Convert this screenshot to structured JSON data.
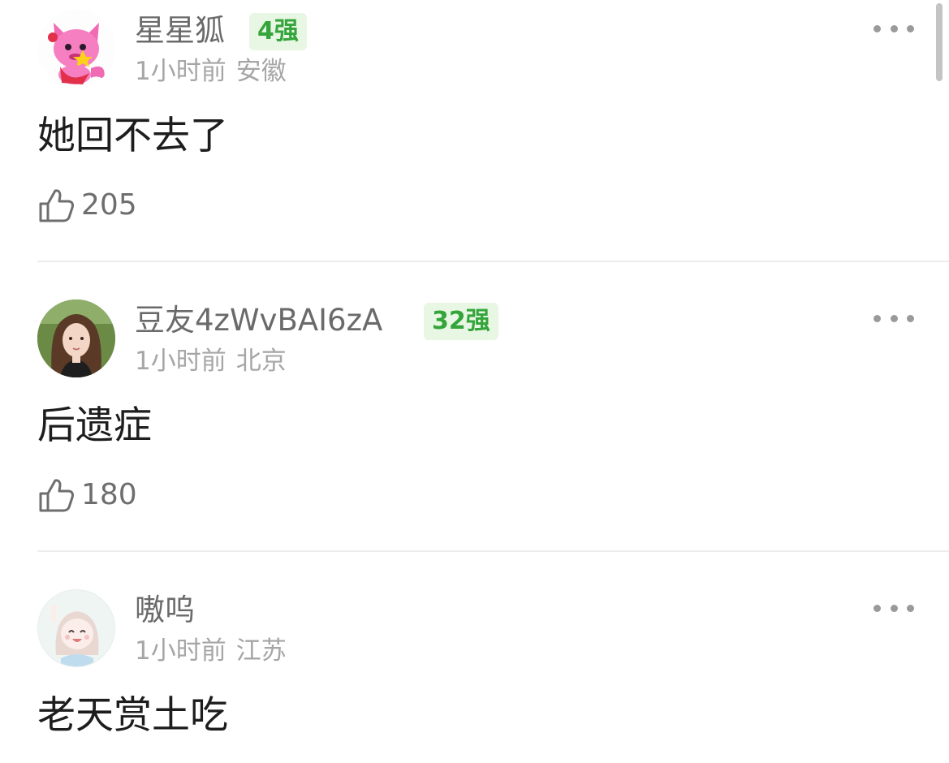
{
  "comments": [
    {
      "username": "星星狐",
      "badge": "4强",
      "time": "1小时前",
      "location": "安徽",
      "text": "她回不去了",
      "likes": "205",
      "avatar_icon": "pink-fox-avatar"
    },
    {
      "username": "豆友4zWvBAI6zA",
      "badge": "32强",
      "time": "1小时前",
      "location": "北京",
      "text": "后遗症",
      "likes": "180",
      "avatar_icon": "girl-photo-avatar"
    },
    {
      "username": "嗷呜",
      "time": "1小时前",
      "location": "江苏",
      "text": "老天赏土吃",
      "avatar_icon": "anime-girl-avatar"
    }
  ],
  "colors": {
    "badge_text": "#34a53a",
    "badge_bg": "#e8f6e4",
    "username": "#6a6a6a",
    "meta": "#a6a6a6",
    "content": "#1d1d1d"
  }
}
